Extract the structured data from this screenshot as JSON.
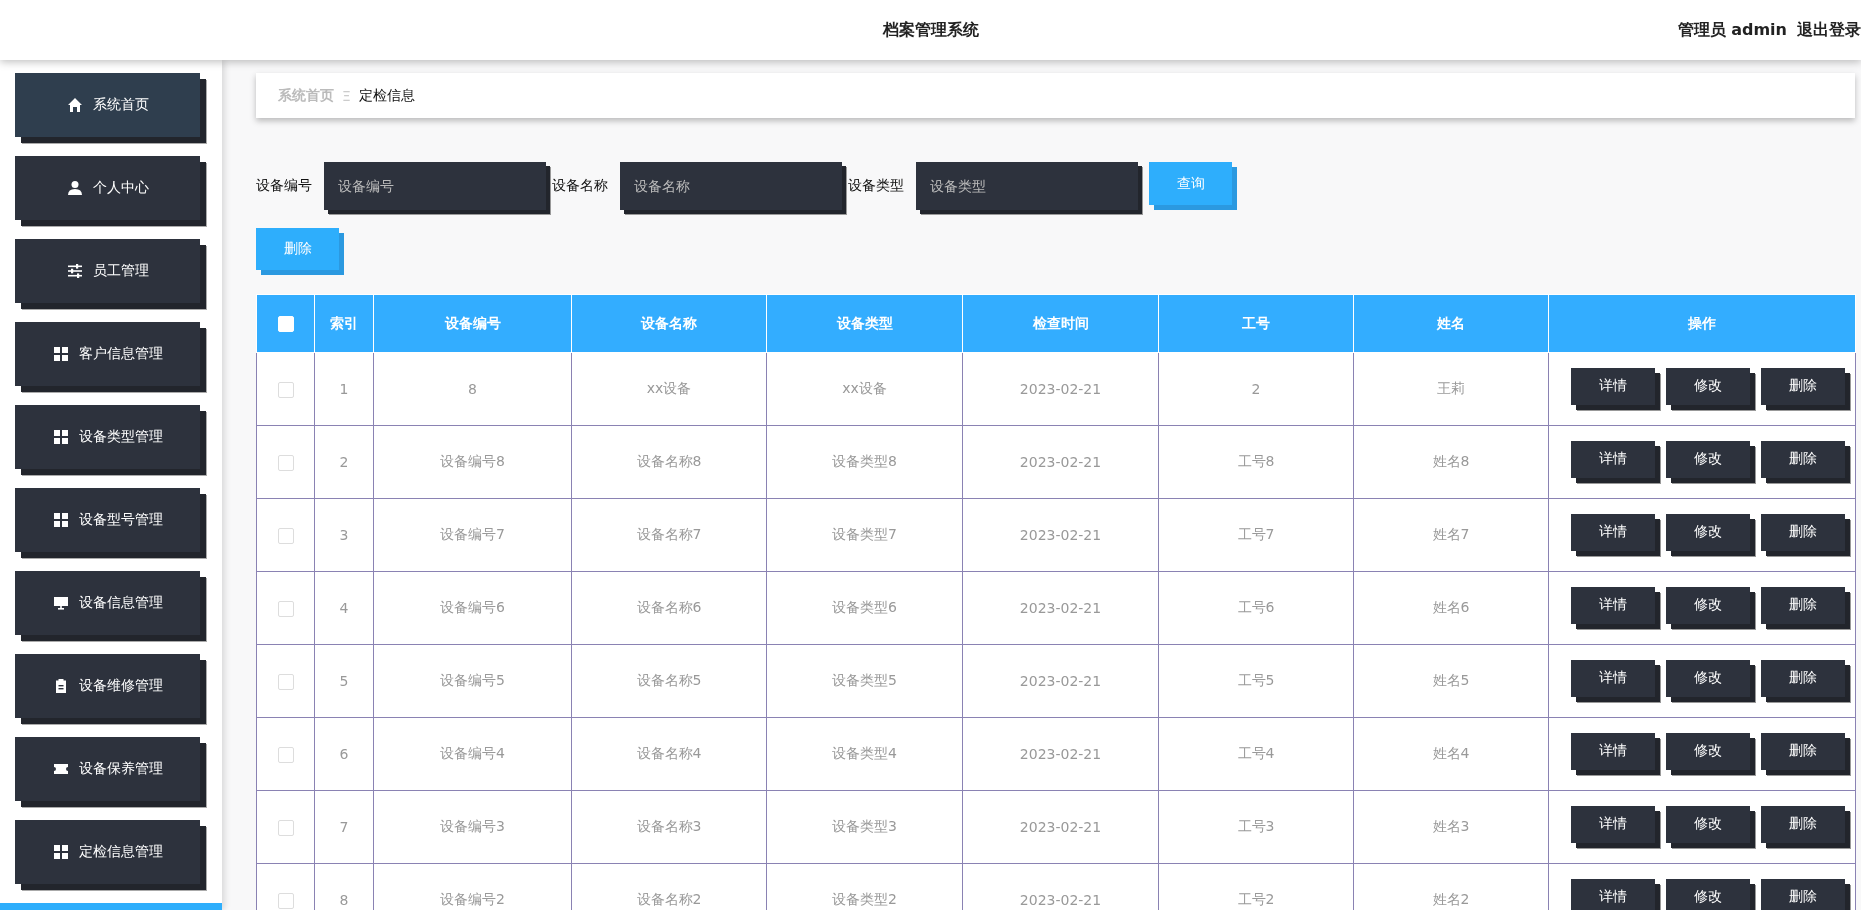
{
  "header": {
    "title": "档案管理系统",
    "user": "管理员 admin",
    "logout": "退出登录"
  },
  "sidebar": {
    "items": [
      {
        "label": "系统首页",
        "selected": false
      },
      {
        "label": "个人中心",
        "selected": false
      },
      {
        "label": "员工管理",
        "selected": false
      },
      {
        "label": "客户信息管理",
        "selected": false
      },
      {
        "label": "设备类型管理",
        "selected": false
      },
      {
        "label": "设备型号管理",
        "selected": false
      },
      {
        "label": "设备信息管理",
        "selected": false
      },
      {
        "label": "设备维修管理",
        "selected": false
      },
      {
        "label": "设备保养管理",
        "selected": false
      },
      {
        "label": "定检信息管理",
        "selected": false
      },
      {
        "selected": true
      }
    ]
  },
  "breadcrumb": {
    "home": "系统首页",
    "separator": "Ξ",
    "current": "定检信息"
  },
  "search": {
    "fields": [
      {
        "label": "设备编号",
        "placeholder": "设备编号"
      },
      {
        "label": "设备名称",
        "placeholder": "设备名称"
      },
      {
        "label": "设备类型",
        "placeholder": "设备类型"
      }
    ],
    "button": "查询"
  },
  "delete_button": "删除",
  "table": {
    "select_all_checked": false,
    "columns": [
      "索引",
      "设备编号",
      "设备名称",
      "设备类型",
      "检查时间",
      "工号",
      "姓名",
      "操作"
    ],
    "rows": [
      {
        "checked": false,
        "cells": [
          "1",
          "8",
          "xx设备",
          "xx设备",
          "2023-02-21",
          "2",
          "王莉"
        ],
        "actions": [
          "详情",
          "修改",
          "删除"
        ]
      },
      {
        "checked": false,
        "cells": [
          "2",
          "设备编号8",
          "设备名称8",
          "设备类型8",
          "2023-02-21",
          "工号8",
          "姓名8"
        ],
        "actions": [
          "详情",
          "修改",
          "删除"
        ]
      },
      {
        "checked": false,
        "cells": [
          "3",
          "设备编号7",
          "设备名称7",
          "设备类型7",
          "2023-02-21",
          "工号7",
          "姓名7"
        ],
        "actions": [
          "详情",
          "修改",
          "删除"
        ]
      },
      {
        "checked": false,
        "cells": [
          "4",
          "设备编号6",
          "设备名称6",
          "设备类型6",
          "2023-02-21",
          "工号6",
          "姓名6"
        ],
        "actions": [
          "详情",
          "修改",
          "删除"
        ]
      },
      {
        "checked": false,
        "cells": [
          "5",
          "设备编号5",
          "设备名称5",
          "设备类型5",
          "2023-02-21",
          "工号5",
          "姓名5"
        ],
        "actions": [
          "详情",
          "修改",
          "删除"
        ]
      },
      {
        "checked": false,
        "cells": [
          "6",
          "设备编号4",
          "设备名称4",
          "设备类型4",
          "2023-02-21",
          "工号4",
          "姓名4"
        ],
        "actions": [
          "详情",
          "修改",
          "删除"
        ]
      },
      {
        "checked": false,
        "cells": [
          "7",
          "设备编号3",
          "设备名称3",
          "设备类型3",
          "2023-02-21",
          "工号3",
          "姓名3"
        ],
        "actions": [
          "详情",
          "修改",
          "删除"
        ]
      },
      {
        "checked": false,
        "cells": [
          "8",
          "设备编号2",
          "设备名称2",
          "设备类型2",
          "2023-02-21",
          "工号2",
          "姓名2"
        ],
        "actions": [
          "详情",
          "修改",
          "删除"
        ]
      }
    ]
  }
}
